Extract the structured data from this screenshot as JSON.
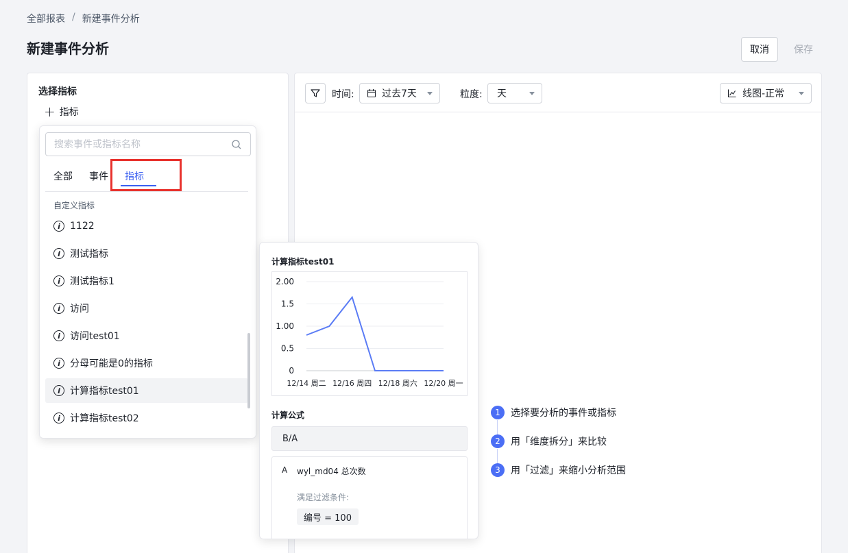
{
  "breadcrumb": {
    "root": "全部报表",
    "separator": "/",
    "current": "新建事件分析"
  },
  "page_title": "新建事件分析",
  "actions": {
    "cancel": "取消",
    "save": "保存"
  },
  "left_panel": {
    "title": "选择指标",
    "add_label": "指标"
  },
  "toolbar": {
    "time_label": "时间:",
    "time_value": "过去7天",
    "granularity_label": "粒度:",
    "granularity_value": "天",
    "chart_type_value": "线图-正常"
  },
  "dropdown": {
    "search_placeholder": "搜索事件或指标名称",
    "tabs": [
      {
        "label": "全部",
        "active": false
      },
      {
        "label": "事件",
        "active": false
      },
      {
        "label": "指标",
        "active": true
      }
    ],
    "group_title": "自定义指标",
    "items": [
      {
        "label": "1122"
      },
      {
        "label": "测试指标"
      },
      {
        "label": "测试指标1"
      },
      {
        "label": "访问"
      },
      {
        "label": "访问test01"
      },
      {
        "label": "分母可能是0的指标"
      },
      {
        "label": "计算指标test01",
        "hovered": true
      },
      {
        "label": "计算指标test02"
      }
    ]
  },
  "tooltip": {
    "title": "计算指标test01",
    "formula_title": "计算公式",
    "formula": "B/A",
    "detail_key": "A",
    "detail_name": "wyl_md04 总次数",
    "detail_sub": "满足过滤条件:",
    "detail_chip": "编号 = 100"
  },
  "chart_data": {
    "type": "line",
    "x": [
      "12/14",
      "12/15",
      "12/16",
      "12/17",
      "12/18",
      "12/19",
      "12/20"
    ],
    "xticks": [
      "12/14 周二",
      "12/16 周四",
      "12/18 周六",
      "12/20 周一"
    ],
    "yticks": [
      "2.00",
      "1.5",
      "1.00",
      "0.5",
      "0"
    ],
    "values": [
      0.8,
      1.0,
      1.65,
      0,
      0,
      0,
      0
    ],
    "ylim": [
      0,
      2
    ],
    "color": "#5b7cf5"
  },
  "steps": [
    {
      "num": "1",
      "label": "选择要分析的事件或指标"
    },
    {
      "num": "2",
      "label": "用「维度拆分」来比较"
    },
    {
      "num": "3",
      "label": "用「过滤」来缩小分析范围"
    }
  ],
  "colors": {
    "accent": "#3a5ff0",
    "highlight": "#e8322d",
    "step": "#4b6ef5"
  }
}
